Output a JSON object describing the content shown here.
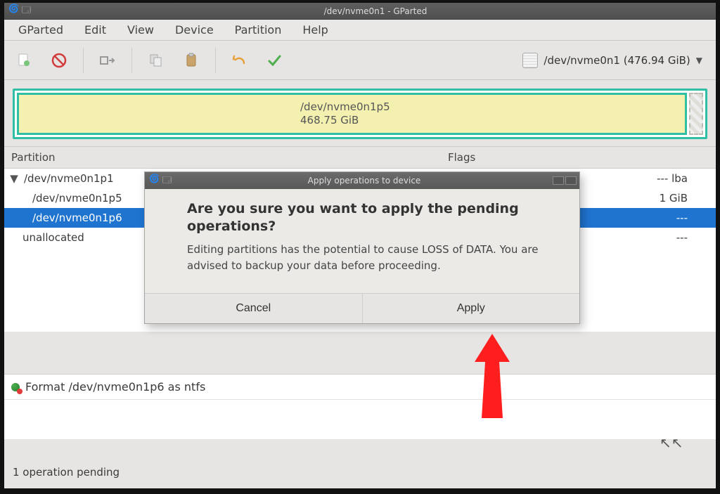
{
  "titlebar": {
    "title": "/dev/nvme0n1 - GParted"
  },
  "menubar": {
    "items": [
      "GParted",
      "Edit",
      "View",
      "Device",
      "Partition",
      "Help"
    ]
  },
  "device_chooser": {
    "label": "/dev/nvme0n1 (476.94 GiB)"
  },
  "partmap": {
    "main_name": "/dev/nvme0n1p5",
    "main_size": "468.75 GiB"
  },
  "table": {
    "headers": {
      "partition": "Partition",
      "flags": "Flags"
    },
    "rows": [
      {
        "name": "/dev/nvme0n1p1",
        "indent": 1,
        "expandable": true,
        "flags": "lba"
      },
      {
        "name": "/dev/nvme0n1p5",
        "indent": 2,
        "expandable": false,
        "flags_tail": "1 GiB"
      },
      {
        "name": "/dev/nvme0n1p6",
        "indent": 2,
        "expandable": false,
        "selected": true,
        "flags": "---"
      },
      {
        "name": "unallocated",
        "indent": 1,
        "expandable": false,
        "flags": "---"
      }
    ]
  },
  "pending": {
    "text": "Format /dev/nvme0n1p6 as ntfs"
  },
  "statusbar": {
    "text": "1 operation pending"
  },
  "dialog": {
    "title": "Apply operations to device",
    "heading": "Are you sure you want to apply the pending operations?",
    "body": "Editing partitions has the potential to cause LOSS of DATA. You are advised to backup your data before proceeding.",
    "cancel": "Cancel",
    "apply": "Apply"
  }
}
